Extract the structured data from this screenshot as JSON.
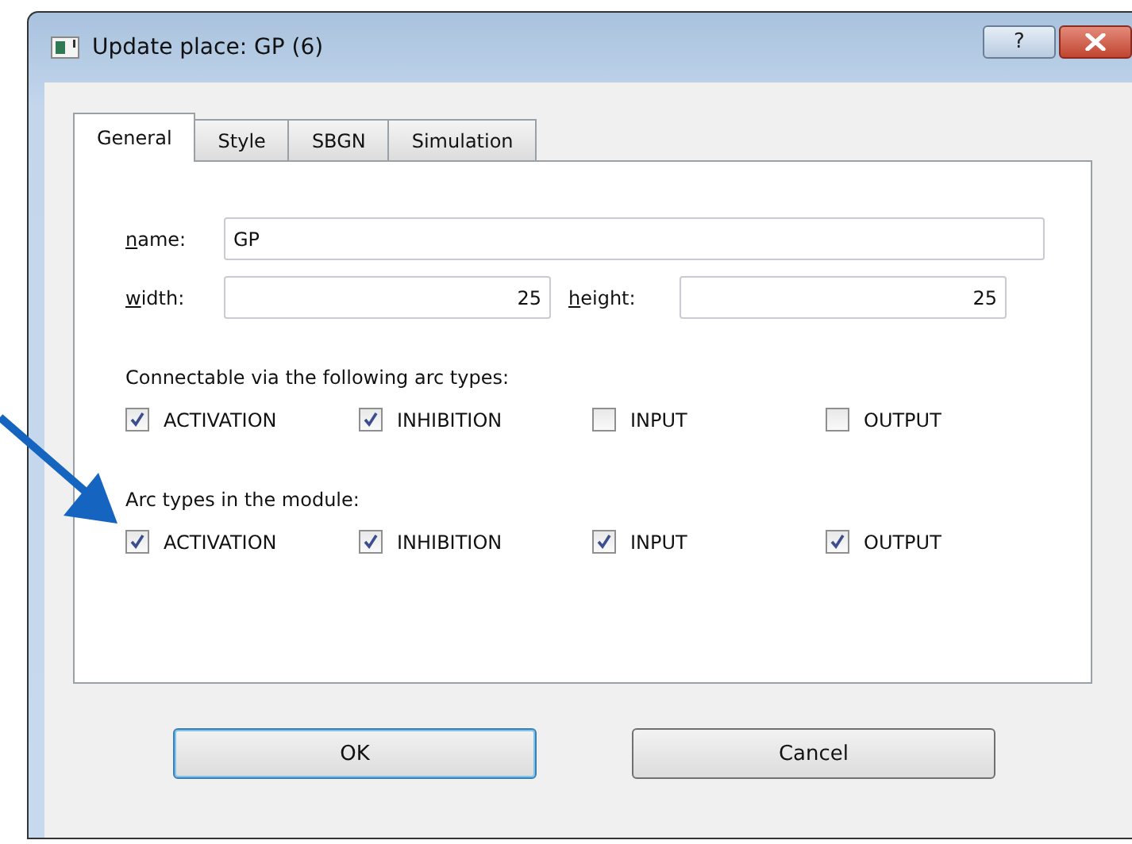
{
  "window": {
    "title": "Update place: GP (6)",
    "help_label": "?"
  },
  "tabs": [
    {
      "label": "General",
      "selected": true
    },
    {
      "label": "Style",
      "selected": false
    },
    {
      "label": "SBGN",
      "selected": false
    },
    {
      "label": "Simulation",
      "selected": false
    }
  ],
  "name_field": {
    "label": "name:",
    "value": "GP"
  },
  "size_fields": [
    {
      "label": "width:",
      "value": "25"
    },
    {
      "label": "height:",
      "value": "25"
    }
  ],
  "groups": [
    {
      "title": "Connectable via the following arc types:",
      "options": [
        {
          "label": "ACTIVATION",
          "checked": true
        },
        {
          "label": "INHIBITION",
          "checked": true
        },
        {
          "label": "INPUT",
          "checked": false
        },
        {
          "label": "OUTPUT",
          "checked": false
        }
      ]
    },
    {
      "title": "Arc types in the module:",
      "options": [
        {
          "label": "ACTIVATION",
          "checked": true
        },
        {
          "label": "INHIBITION",
          "checked": true
        },
        {
          "label": "INPUT",
          "checked": true
        },
        {
          "label": "OUTPUT",
          "checked": true
        }
      ]
    }
  ],
  "buttons": [
    {
      "label": "OK",
      "default": true
    },
    {
      "label": "Cancel",
      "default": false
    }
  ]
}
